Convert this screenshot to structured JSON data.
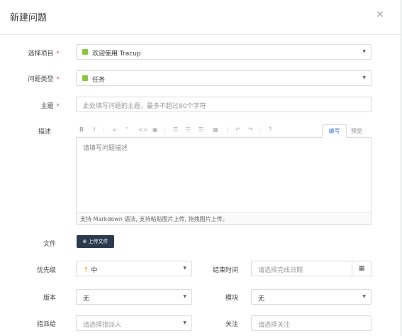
{
  "dialog": {
    "title": "新建问题"
  },
  "form": {
    "project": {
      "label": "选择项目",
      "value": "欢迎使用 Tracup",
      "color": "#8cc63f"
    },
    "type": {
      "label": "问题类型",
      "value": "任务",
      "color": "#8cc63f"
    },
    "subject": {
      "label": "主题",
      "placeholder": "此处填写问题的主题，最多不超过80个字符"
    },
    "description": {
      "label": "描述",
      "tab_edit": "编写",
      "tab_preview": "预览",
      "placeholder": "请填写问题描述",
      "hint": "支持 Markdown 语法, 支持粘贴图片上传, 拖拽图片上传。"
    },
    "file": {
      "label": "文件",
      "upload_label": "上传文件"
    },
    "priority": {
      "label": "优先级",
      "value": "中"
    },
    "end_time": {
      "label": "结束时间",
      "placeholder": "请选择完成日期"
    },
    "version": {
      "label": "版本",
      "value": "无"
    },
    "module": {
      "label": "模块",
      "value": "无"
    },
    "assignee": {
      "label": "指派给",
      "placeholder": "请选择指派人"
    },
    "watch": {
      "label": "关注",
      "placeholder": "请选择关注"
    }
  },
  "toolbar": {
    "icons": [
      "bold-icon",
      "italic-icon",
      "link-icon",
      "quote-icon",
      "code-icon",
      "image-icon",
      "ordered-list-icon",
      "unordered-list-icon",
      "checklist-icon",
      "table-icon",
      "undo-icon",
      "redo-icon",
      "help-icon"
    ]
  }
}
